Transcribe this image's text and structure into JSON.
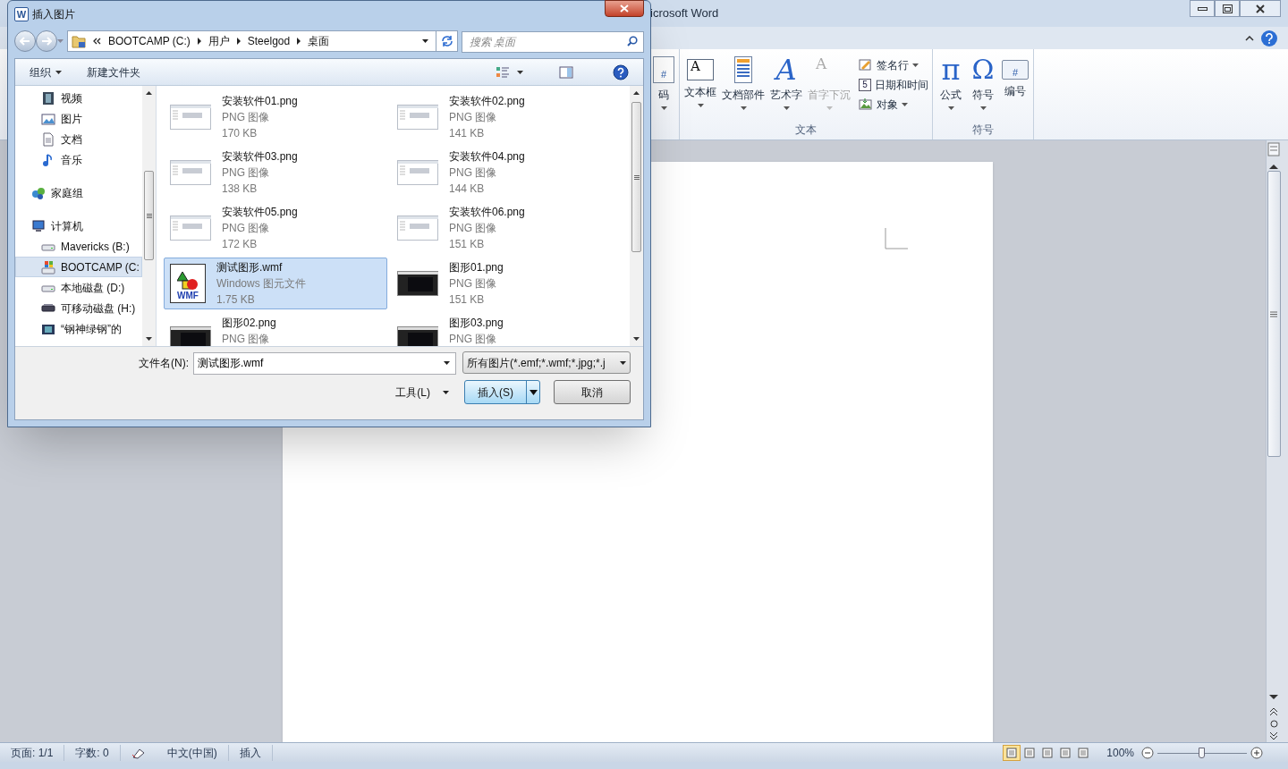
{
  "word": {
    "title": "icrosoft Word",
    "ribbon_groups": [
      {
        "large": [
          {
            "label": "码",
            "glyph": "#",
            "dropdown": true,
            "disabled": false,
            "kind": "page-number"
          }
        ]
      },
      {
        "label": "文本",
        "large": [
          {
            "label": "文本框",
            "glyph": "A",
            "dropdown": true,
            "disabled": false,
            "kind": "textbox"
          },
          {
            "label": "文档部件",
            "dropdown": true,
            "disabled": false,
            "kind": "parts"
          },
          {
            "label": "艺术字",
            "glyph": "A",
            "dropdown": true,
            "disabled": false,
            "kind": "wordart"
          },
          {
            "label": "首字下沉",
            "glyph": "A",
            "dropdown": true,
            "disabled": true,
            "kind": "dropcap"
          }
        ],
        "small": [
          {
            "label": "签名行",
            "dropdown": true,
            "kind": "signature"
          },
          {
            "label": "日期和时间",
            "glyph": "5",
            "dropdown": false,
            "kind": "date"
          },
          {
            "label": "对象",
            "dropdown": true,
            "kind": "object"
          }
        ]
      },
      {
        "label": "符号",
        "large": [
          {
            "label": "公式",
            "glyph": "π",
            "dropdown": true,
            "disabled": false,
            "kind": "pi"
          },
          {
            "label": "符号",
            "glyph": "Ω",
            "dropdown": true,
            "disabled": false,
            "kind": "omega"
          },
          {
            "label": "编号",
            "glyph": "#",
            "dropdown": false,
            "disabled": false,
            "kind": "number"
          }
        ]
      }
    ],
    "status_bar": {
      "items": [
        "页面: 1/1",
        "字数: 0",
        "中文(中国)",
        "插入"
      ],
      "zoom": "100%",
      "zoom_slider": {
        "level": 0.5
      }
    }
  },
  "dialog": {
    "title": "插入图片",
    "app_icon": "W",
    "breadcrumb": [
      "BOOTCAMP (C:)",
      "用户",
      "Steelgod",
      "桌面"
    ],
    "search": {
      "placeholder": "搜索 桌面"
    },
    "toolbar": [
      {
        "label": "组织",
        "dropdown": true
      },
      {
        "label": "新建文件夹",
        "dropdown": false
      }
    ],
    "nav": [
      {
        "label": "视频",
        "kind": "video",
        "selected": false
      },
      {
        "label": "图片",
        "kind": "picture",
        "selected": false
      },
      {
        "label": "文档",
        "kind": "doc",
        "selected": false
      },
      {
        "label": "音乐",
        "kind": "music",
        "selected": false
      },
      {
        "label": "家庭组",
        "kind": "homegroup",
        "selected": false,
        "top": true
      },
      {
        "label": "计算机",
        "kind": "computer",
        "selected": false,
        "top": true,
        "children": [
          {
            "label": "Mavericks (B:)",
            "kind": "drive",
            "selected": false
          },
          {
            "label": "BOOTCAMP (C:",
            "kind": "windrive",
            "selected": true
          },
          {
            "label": "本地磁盘 (D:)",
            "kind": "drive",
            "selected": false
          },
          {
            "label": "可移动磁盘 (H:)",
            "kind": "removable",
            "selected": false
          },
          {
            "label": "“钢神绿钢”的",
            "kind": "media",
            "selected": false
          }
        ]
      }
    ],
    "files": [
      {
        "name": "安装软件01.png",
        "type": "PNG 图像",
        "size": "170 KB",
        "kind": "light",
        "selected": false
      },
      {
        "name": "安装软件02.png",
        "type": "PNG 图像",
        "size": "141 KB",
        "kind": "light",
        "selected": false
      },
      {
        "name": "安装软件03.png",
        "type": "PNG 图像",
        "size": "138 KB",
        "kind": "light",
        "selected": false
      },
      {
        "name": "安装软件04.png",
        "type": "PNG 图像",
        "size": "144 KB",
        "kind": "light",
        "selected": false
      },
      {
        "name": "安装软件05.png",
        "type": "PNG 图像",
        "size": "172 KB",
        "kind": "light",
        "selected": false
      },
      {
        "name": "安装软件06.png",
        "type": "PNG 图像",
        "size": "151 KB",
        "kind": "light",
        "selected": false
      },
      {
        "name": "测试图形.wmf",
        "type": "Windows 图元文件",
        "size": "1.75 KB",
        "kind": "wmf",
        "icon_text": "WMF",
        "selected": true
      },
      {
        "name": "图形01.png",
        "type": "PNG 图像",
        "size": "151 KB",
        "kind": "dark",
        "selected": false
      },
      {
        "name": "图形02.png",
        "type": "PNG 图像",
        "kind": "dark",
        "selected": false
      },
      {
        "name": "图形03.png",
        "type": "PNG 图像",
        "kind": "dark",
        "selected": false
      }
    ],
    "filename_label": "文件名(N):",
    "filename": "测试图形.wmf",
    "filter": "所有图片(*.emf;*.wmf;*.jpg;*.j",
    "tools": "工具(L)",
    "insert": "插入(S)",
    "cancel": "取消"
  }
}
